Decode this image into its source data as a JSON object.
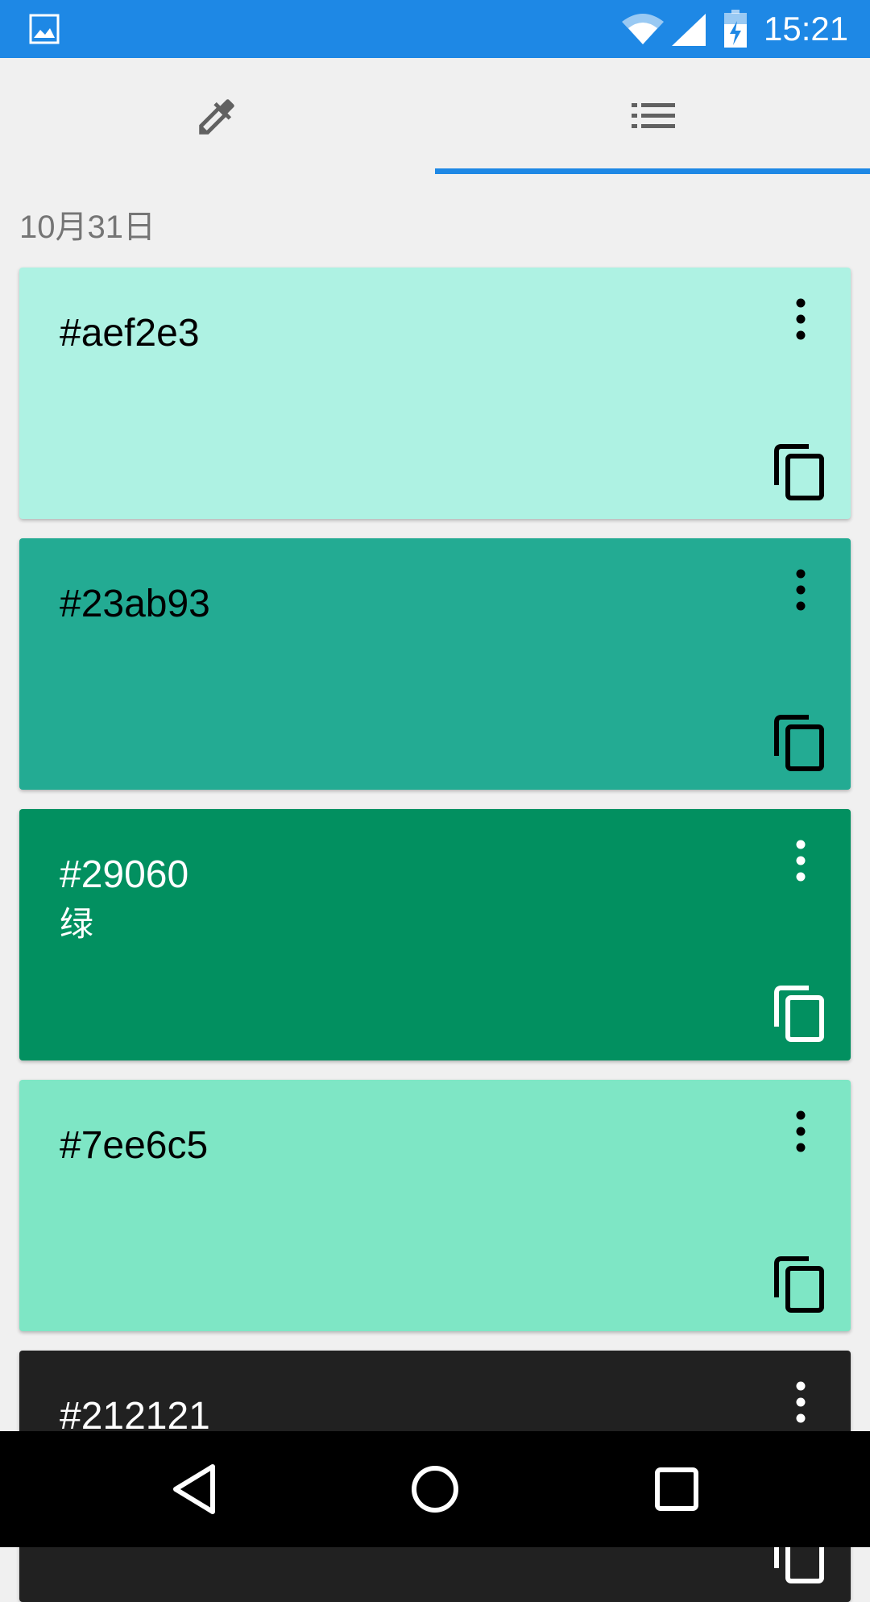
{
  "status_bar": {
    "time": "15:21"
  },
  "tabs": [
    {
      "icon": "eyedropper-icon",
      "selected": false
    },
    {
      "icon": "list-icon",
      "selected": true
    }
  ],
  "accent_color": "#1e88e5",
  "history": {
    "date": "10月31日",
    "colors": [
      {
        "hex": "#aef2e3",
        "name": "",
        "background": "#aef2e3",
        "text_color": "#000000"
      },
      {
        "hex": "#23ab93",
        "name": "",
        "background": "#23ab93",
        "text_color": "#000000"
      },
      {
        "hex": "#29060",
        "name": "绿",
        "background": "#029060",
        "text_color": "#ffffff"
      },
      {
        "hex": "#7ee6c5",
        "name": "",
        "background": "#7ee6c5",
        "text_color": "#000000"
      },
      {
        "hex": "#212121",
        "name": "",
        "background": "#212121",
        "text_color": "#ffffff"
      }
    ]
  }
}
